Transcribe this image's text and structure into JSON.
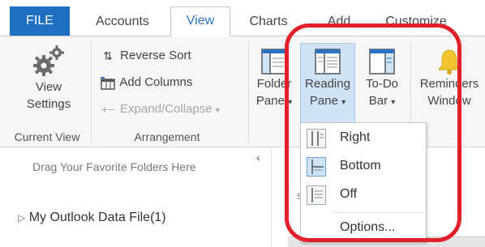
{
  "tabs": {
    "file": "FILE",
    "accounts": "Accounts",
    "view": "View",
    "charts": "Charts",
    "add": "Add",
    "customize": "Customize"
  },
  "ribbon": {
    "view_settings": {
      "line1": "View",
      "line2": "Settings"
    },
    "current_view_label": "Current View",
    "reverse_sort": "Reverse Sort",
    "add_columns": "Add Columns",
    "expand_collapse": "Expand/Collapse",
    "arrangement_label": "Arrangement",
    "folder_pane": {
      "line1": "Folder",
      "line2": "Pane"
    },
    "reading_pane": {
      "line1": "Reading",
      "line2": "Pane"
    },
    "todo_bar": {
      "line1": "To-Do",
      "line2": "Bar"
    },
    "reminders_window": {
      "line1": "Reminders",
      "line2": "Window"
    }
  },
  "reading_pane_menu": {
    "items": [
      {
        "label": "Right",
        "icon": "reading-pane-right-icon",
        "selected": false
      },
      {
        "label": "Bottom",
        "icon": "reading-pane-bottom-icon",
        "selected": true
      },
      {
        "label": "Off",
        "icon": "reading-pane-off-icon",
        "selected": false
      }
    ],
    "options": "Options..."
  },
  "nav_pane": {
    "favorites_hint": "Drag Your Favorite Folders Here",
    "data_file": "My Outlook Data File(1)"
  },
  "colors": {
    "file_tab": "#1e6fc0",
    "accent": "#2b72c2",
    "highlight_ring": "#e0202a",
    "active_button": "#cfe3f6"
  }
}
